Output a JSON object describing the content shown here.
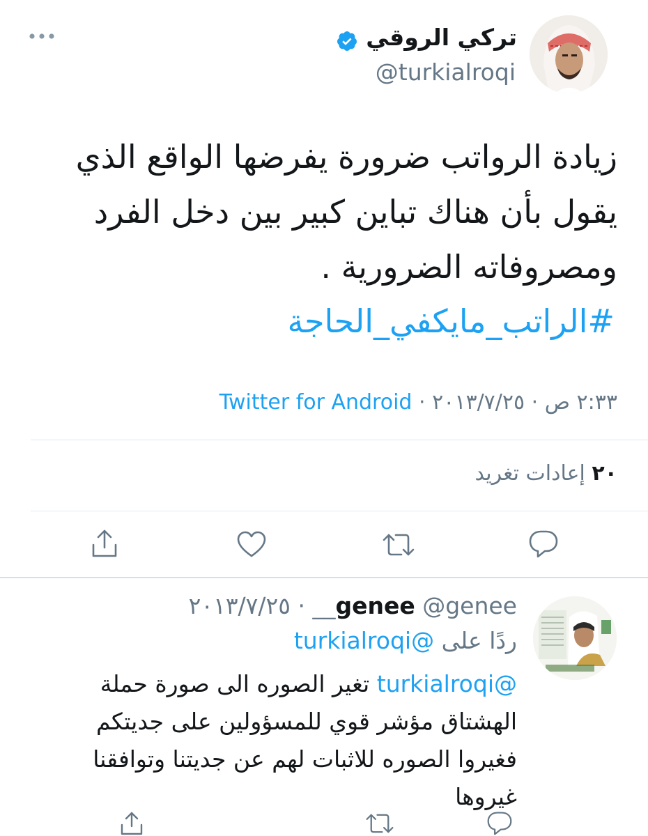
{
  "tweet": {
    "author_name": "تركي الروقي",
    "author_handle": "@turkialroqi",
    "body_lines": [
      "زيادة الرواتب ضرورة يفرضها الواقع الذي",
      "يقول بأن هناك تباين كبير بين دخل الفرد",
      "ومصروفاته الضرورية ."
    ],
    "hashtag": "#الراتب_مايكفي_الحاجة",
    "timestamp": "٢:٣٣ ص · ٢٠١٣/٧/٢٥",
    "separator": "·",
    "source": "Twitter for Android",
    "retweet_count": "٢٠",
    "retweet_label": "إعادات تغريد",
    "colors": {
      "link": "#1da1f2",
      "muted": "#657786",
      "divider": "#e1e8ed"
    }
  },
  "reply": {
    "author_name": "genee",
    "author_handle": "@genee__",
    "date": "٢٠١٣/٧/٢٥",
    "dot": "·",
    "replying_to_label": "ردًا على",
    "replying_to_handle": "@turkialroqi",
    "mention": "@turkialroqi",
    "body_first": "تغير الصوره الى صورة حملة",
    "body_lines": [
      "الهشتاق مؤشر قوي للمسؤولين على جديتكم",
      "فغيروا الصوره للاثبات لهم عن جديتنا وتوافقنا",
      "غيروها"
    ]
  },
  "icons": [
    "more-icon",
    "verified-icon",
    "reply-icon",
    "retweet-icon",
    "like-icon",
    "share-icon"
  ]
}
